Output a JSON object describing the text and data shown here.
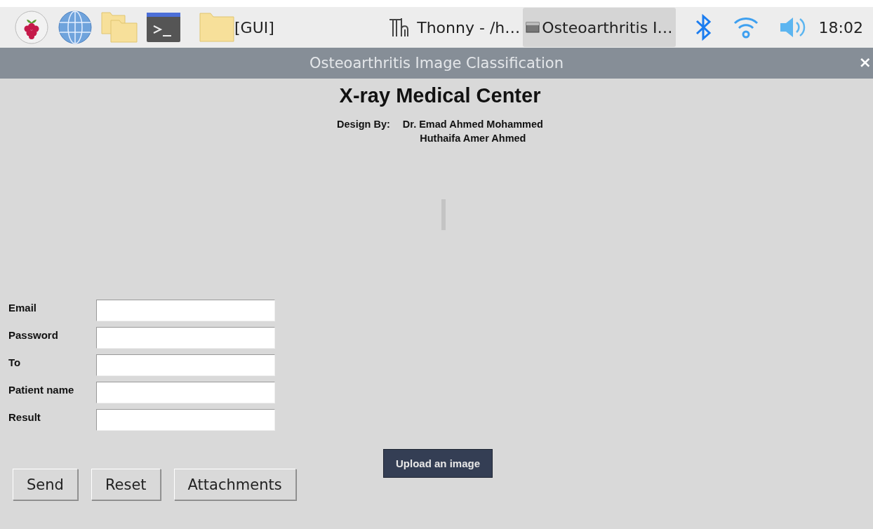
{
  "taskbar": {
    "launchers": [
      {
        "kind": "raspberry"
      },
      {
        "kind": "globe"
      },
      {
        "kind": "folders"
      },
      {
        "kind": "terminal"
      },
      {
        "kind": "folder",
        "label": "[GUI]"
      }
    ],
    "tasks": [
      {
        "kind": "thonny",
        "label": "Thonny  -  /h…",
        "selected": false
      },
      {
        "kind": "window",
        "label": "Osteoarthritis I…",
        "selected": true
      }
    ],
    "tray": [
      {
        "kind": "bluetooth"
      },
      {
        "kind": "wifi"
      },
      {
        "kind": "volume"
      }
    ],
    "clock": "18:02"
  },
  "window": {
    "title": "Osteoarthritis Image Classification",
    "close": "×"
  },
  "header": {
    "title": "X-ray Medical Center",
    "design_label": "Design By:",
    "designers": [
      "Dr. Emad Ahmed Mohammed",
      "Huthaifa Amer Ahmed"
    ]
  },
  "form": {
    "fields": [
      {
        "label": "Email"
      },
      {
        "label": "Password"
      },
      {
        "label": "To"
      },
      {
        "label": "Patient name"
      },
      {
        "label": "Result"
      }
    ],
    "buttons": [
      "Send",
      "Reset",
      "Attachments"
    ]
  },
  "upload_button": "Upload an image"
}
